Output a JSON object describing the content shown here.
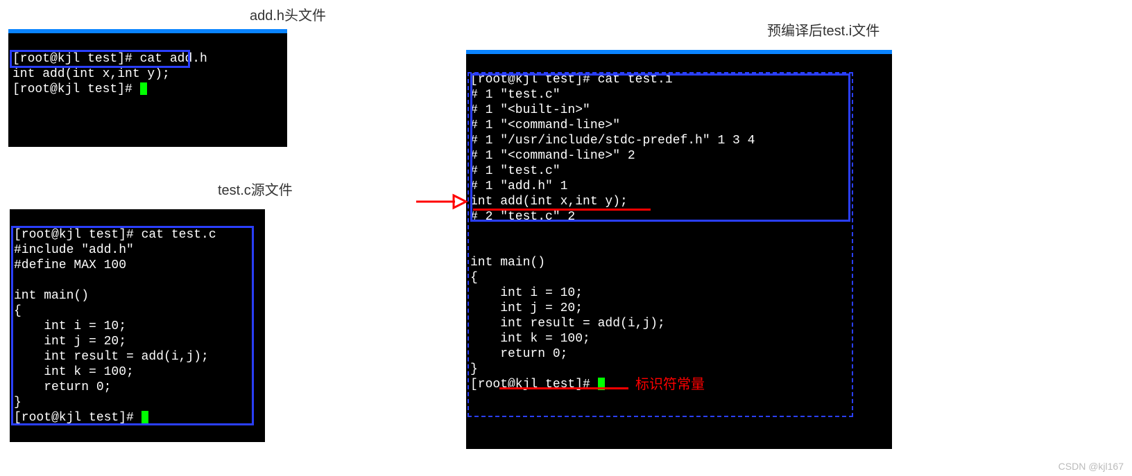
{
  "labels": {
    "addh_title": "add.h头文件",
    "testc_title": "test.c源文件",
    "testi_title": "预编译后test.i文件",
    "annotation": "标识符常量",
    "watermark": "CSDN @kjl167"
  },
  "terminals": {
    "addh": {
      "prompt1": "[root@kjl test]# cat add.h",
      "line1": "int add(int x,int y);",
      "prompt2": "[root@kjl test]# "
    },
    "testc": {
      "prompt1": "[root@kjl test]# cat test.c",
      "body": "#include \"add.h\"\n#define MAX 100\n\nint main()\n{\n    int i = 10;\n    int j = 20;\n    int result = add(i,j);\n    int k = 100;\n    return 0;\n}",
      "prompt2": "[root@kjl test]# "
    },
    "testi": {
      "prompt1": "[root@kjl test]# cat test.i",
      "body_top": "# 1 \"test.c\"\n# 1 \"<built-in>\"\n# 1 \"<command-line>\"\n# 1 \"/usr/include/stdc-predef.h\" 1 3 4\n# 1 \"<command-line>\" 2\n# 1 \"test.c\"\n# 1 \"add.h\" 1",
      "line_add": "int add(int x,int y);",
      "line_after": "# 2 \"test.c\" 2",
      "body_main": "\n\nint main()\n{\n    int i = 10;\n    int j = 20;\n    int result = add(i,j);\n    int k = 100;\n    return 0;\n}",
      "prompt2": "[root@kjl test]# "
    }
  }
}
